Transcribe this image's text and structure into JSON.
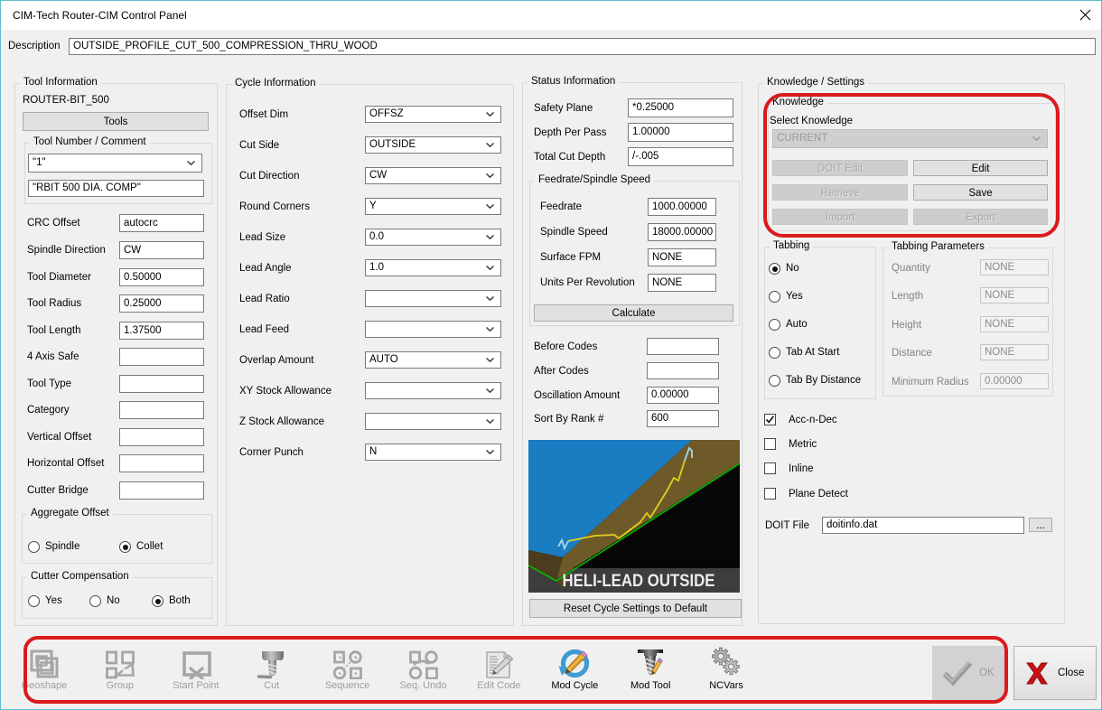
{
  "window": {
    "title": "CIM-Tech Router-CIM Control Panel"
  },
  "description": {
    "label": "Description",
    "value": "OUTSIDE_PROFILE_CUT_500_COMPRESSION_THRU_WOOD"
  },
  "tool_info": {
    "title": "Tool Information",
    "tool_name": "ROUTER-BIT_500",
    "tools_button": "Tools",
    "tnc": {
      "title": "Tool Number / Comment",
      "number": "\"1\"",
      "comment": "\"RBIT 500 DIA. COMP\""
    },
    "fields": [
      {
        "label": "CRC Offset",
        "value": "autocrc"
      },
      {
        "label": "Spindle Direction",
        "value": "CW"
      },
      {
        "label": "Tool Diameter",
        "value": "0.50000"
      },
      {
        "label": "Tool Radius",
        "value": "0.25000"
      },
      {
        "label": "Tool Length",
        "value": "1.37500"
      },
      {
        "label": "4 Axis Safe",
        "value": ""
      },
      {
        "label": "Tool Type",
        "value": ""
      },
      {
        "label": "Category",
        "value": ""
      },
      {
        "label": "Vertical Offset",
        "value": ""
      },
      {
        "label": "Horizontal Offset",
        "value": ""
      },
      {
        "label": "Cutter Bridge",
        "value": ""
      }
    ],
    "aggregate": {
      "title": "Aggregate Offset",
      "options": [
        {
          "label": "Spindle",
          "selected": false
        },
        {
          "label": "Collet",
          "selected": true
        }
      ]
    },
    "compensation": {
      "title": "Cutter Compensation",
      "options": [
        {
          "label": "Yes",
          "selected": false
        },
        {
          "label": "No",
          "selected": false
        },
        {
          "label": "Both",
          "selected": true
        }
      ]
    }
  },
  "cycle_info": {
    "title": "Cycle Information",
    "fields": [
      {
        "label": "Offset Dim",
        "value": "OFFSZ"
      },
      {
        "label": "Cut Side",
        "value": "OUTSIDE"
      },
      {
        "label": "Cut Direction",
        "value": "CW"
      },
      {
        "label": "Round Corners",
        "value": "Y"
      },
      {
        "label": "Lead Size",
        "value": "0.0"
      },
      {
        "label": "Lead Angle",
        "value": "1.0"
      },
      {
        "label": "Lead Ratio",
        "value": ""
      },
      {
        "label": "Lead Feed",
        "value": ""
      },
      {
        "label": "Overlap Amount",
        "value": "AUTO"
      },
      {
        "label": "XY Stock Allowance",
        "value": ""
      },
      {
        "label": "Z Stock Allowance",
        "value": ""
      },
      {
        "label": "Corner Punch",
        "value": "N"
      }
    ]
  },
  "status_info": {
    "title": "Status Information",
    "fields": [
      {
        "label": "Safety Plane",
        "value": "*0.25000"
      },
      {
        "label": "Depth Per Pass",
        "value": "1.00000"
      },
      {
        "label": "Total Cut Depth",
        "value": "/-.005"
      }
    ],
    "feedrate": {
      "title": "Feedrate/Spindle Speed",
      "fields": [
        {
          "label": "Feedrate",
          "value": "1000.00000"
        },
        {
          "label": "Spindle Speed",
          "value": "18000.00000"
        },
        {
          "label": "Surface FPM",
          "value": "NONE"
        },
        {
          "label": "Units Per Revolution",
          "value": "NONE"
        }
      ],
      "calculate_button": "Calculate"
    },
    "fields2": [
      {
        "label": "Before Codes",
        "value": ""
      },
      {
        "label": "After Codes",
        "value": ""
      },
      {
        "label": "Oscillation Amount",
        "value": "0.00000"
      },
      {
        "label": "Sort By Rank #",
        "value": "600"
      }
    ],
    "preview": {
      "caption": "HELI-LEAD OUTSIDE"
    },
    "reset_button": "Reset Cycle Settings to Default"
  },
  "knowledge_settings": {
    "title": "Knowledge / Settings",
    "knowledge": {
      "title": "Knowledge",
      "select_label": "Select Knowledge",
      "select_value": "CURRENT",
      "buttons": [
        {
          "label": "DOIT Edit",
          "enabled": false
        },
        {
          "label": "Edit",
          "enabled": true
        },
        {
          "label": "Retrieve",
          "enabled": false
        },
        {
          "label": "Save",
          "enabled": true
        },
        {
          "label": "Import",
          "enabled": false
        },
        {
          "label": "Export",
          "enabled": false
        }
      ]
    },
    "tabbing": {
      "title": "Tabbing",
      "options": [
        {
          "label": "No",
          "selected": true
        },
        {
          "label": "Yes",
          "selected": false
        },
        {
          "label": "Auto",
          "selected": false
        },
        {
          "label": "Tab At Start",
          "selected": false
        },
        {
          "label": "Tab By Distance",
          "selected": false
        }
      ]
    },
    "tabbing_params": {
      "title": "Tabbing Parameters",
      "fields": [
        {
          "label": "Quantity",
          "value": "NONE"
        },
        {
          "label": "Length",
          "value": "NONE"
        },
        {
          "label": "Height",
          "value": "NONE"
        },
        {
          "label": "Distance",
          "value": "NONE"
        },
        {
          "label": "Minimum Radius",
          "value": "0.00000"
        }
      ]
    },
    "checkboxes": [
      {
        "label": "Acc-n-Dec",
        "checked": true
      },
      {
        "label": "Metric",
        "checked": false
      },
      {
        "label": "Inline",
        "checked": false
      },
      {
        "label": "Plane Detect",
        "checked": false
      }
    ],
    "doit": {
      "label": "DOIT File",
      "value": "doitinfo.dat",
      "browse": "..."
    }
  },
  "toolbar": {
    "items": [
      {
        "label": "Geoshape",
        "enabled": false
      },
      {
        "label": "Group",
        "enabled": false
      },
      {
        "label": "Start Point",
        "enabled": false
      },
      {
        "label": "Cut",
        "enabled": false
      },
      {
        "label": "Sequence",
        "enabled": false
      },
      {
        "label": "Seq. Undo",
        "enabled": false
      },
      {
        "label": "Edit Code",
        "enabled": false
      },
      {
        "label": "Mod Cycle",
        "enabled": true
      },
      {
        "label": "Mod Tool",
        "enabled": true
      },
      {
        "label": "NCVars",
        "enabled": true
      }
    ],
    "ok_label": "OK",
    "close_label": "Close"
  },
  "colors": {
    "window_border": "#5fbdd1",
    "dialog_bg": "#f0f0f0",
    "annotation_red": "#da1a1d",
    "preview_blue": "#1a7cc1",
    "preview_brown": "#6e5a28",
    "preview_green": "#00bc00",
    "preview_yellow": "#e3cf1e"
  }
}
